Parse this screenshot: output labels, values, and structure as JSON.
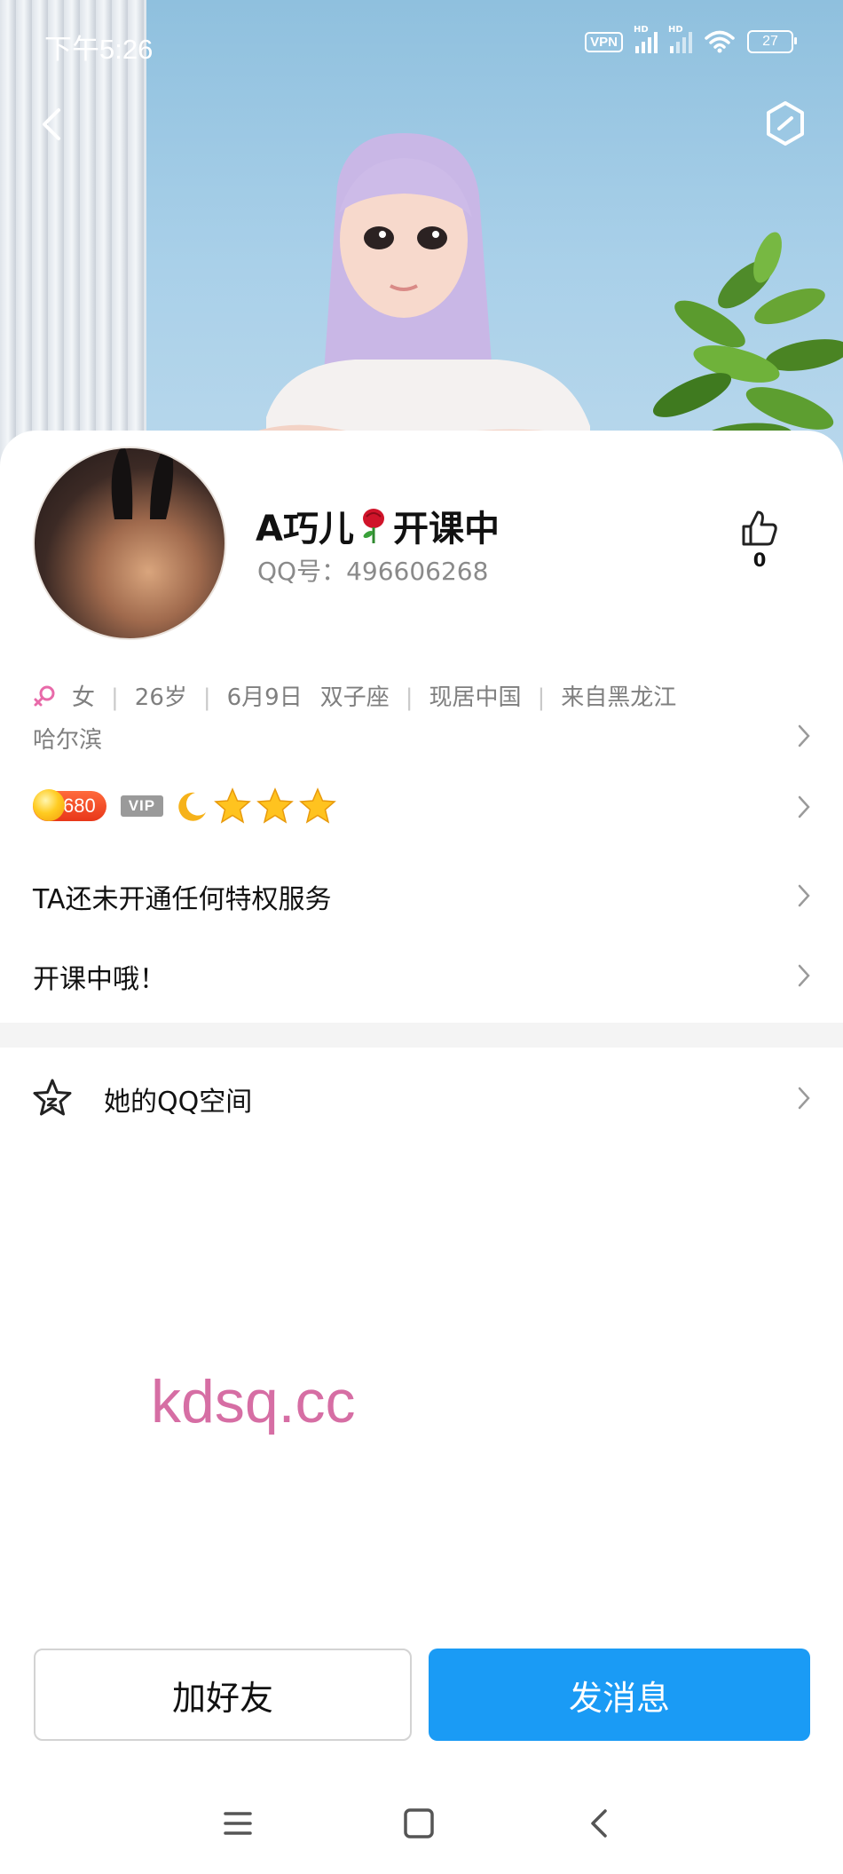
{
  "status_bar": {
    "time": "下午5:26",
    "vpn": "VPN",
    "hd1": "HD",
    "hd2": "HD",
    "battery": "27"
  },
  "icons": {
    "back": "back-chevron-icon",
    "settings": "hexagon-settings-icon",
    "like": "thumbs-up-icon",
    "gender": "female-icon",
    "qzone": "star-icon",
    "chevron": "chevron-right-icon"
  },
  "profile": {
    "name_prefix": "A巧儿",
    "name_suffix": "开课中",
    "qq_label": "QQ号：",
    "qq_number": "496606268",
    "like_count": "0"
  },
  "info": {
    "gender": "女",
    "age": "26岁",
    "birthday": "6月9日",
    "zodiac": "双子座",
    "residence": "现居中国",
    "hometown": "来自黑龙江",
    "hometown_city": "哈尔滨"
  },
  "badges": {
    "level": "680",
    "vip": "VIP",
    "stars_count": 3
  },
  "rows": {
    "privilege": "TA还未开通任何特权服务",
    "signature": "开课中哦！",
    "qzone": "她的QQ空间"
  },
  "watermark": "kdsq.cc",
  "actions": {
    "add_friend": "加好友",
    "send_message": "发消息"
  },
  "colors": {
    "primary": "#1a9bf5",
    "watermark": "#d66ea4",
    "level_badge": "#e8371a"
  }
}
